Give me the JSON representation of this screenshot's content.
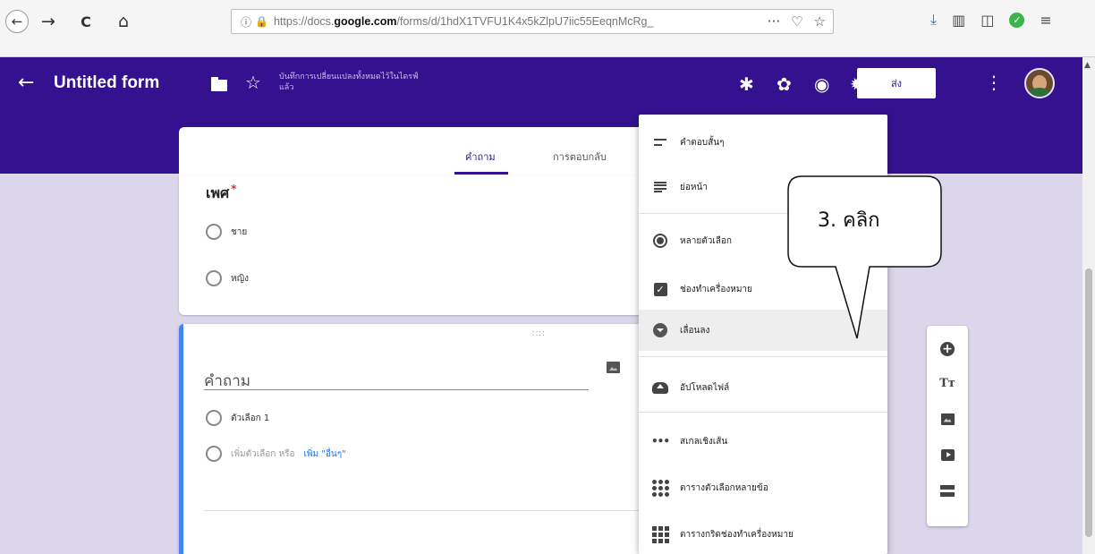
{
  "browser": {
    "url_prefix": "https://docs.",
    "url_domain": "google.com",
    "url_path": "/forms/d/1hdX1TVFU1K4x5kZlpU7iic55EeqnMcRg_",
    "url_more": "···"
  },
  "header": {
    "title": "Untitled form",
    "saved_status": "บันทึกการเปลี่ยนแปลงทั้งหมดไว้ในไดรฟ์แล้ว",
    "send_label": "ส่ง"
  },
  "tabs": {
    "questions": "คำถาม",
    "responses": "การตอบกลับ"
  },
  "question1": {
    "title": "เพศ",
    "required_mark": "*",
    "options": [
      "ชาย",
      "หญิง"
    ]
  },
  "question2": {
    "placeholder": "คำถาม",
    "option1": "ตัวเลือก 1",
    "add_option": "เพิ่มตัวเลือก หรือ",
    "add_other": "เพิ่ม \"อื่นๆ\""
  },
  "menu": {
    "items": [
      {
        "label": "คำตอบสั้นๆ",
        "icon": "short-answer-icon"
      },
      {
        "label": "ย่อหน้า",
        "icon": "paragraph-icon"
      },
      {
        "label": "หลายตัวเลือก",
        "icon": "radio-icon"
      },
      {
        "label": "ช่องทำเครื่องหมาย",
        "icon": "checkbox-icon"
      },
      {
        "label": "เลื่อนลง",
        "icon": "dropdown-icon"
      },
      {
        "label": "อัปโหลดไฟล์",
        "icon": "upload-icon"
      },
      {
        "label": "สเกลเชิงเส้น",
        "icon": "linear-scale-icon"
      },
      {
        "label": "ตารางตัวเลือกหลายข้อ",
        "icon": "grid-dots-icon"
      },
      {
        "label": "ตารางกริดช่องทำเครื่องหมาย",
        "icon": "grid-squares-icon"
      }
    ],
    "highlighted": "เลื่อนลง"
  },
  "callout": {
    "text": "3. คลิก"
  },
  "colors": {
    "brand": "#34128f",
    "page_bg": "#dcd6ea",
    "accent": "#4285f4"
  }
}
